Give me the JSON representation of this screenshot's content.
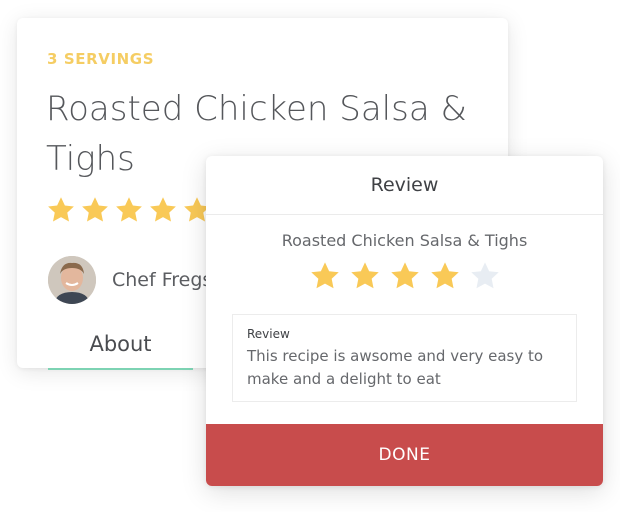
{
  "recipe_card": {
    "servings": "3 SERVINGS",
    "title": "Roasted Chicken Salsa & Tighs",
    "rating": 5,
    "chef_name": "Chef Fregs",
    "tab_about": "About"
  },
  "review_modal": {
    "header": "Review",
    "recipe_name": "Roasted Chicken Salsa & Tighs",
    "rating": 4,
    "max_rating": 5,
    "review_label": "Review",
    "review_text": "This recipe is awsome and very easy to make and a delight to eat",
    "done_label": "DONE"
  },
  "colors": {
    "star_filled": "#f9c957",
    "star_empty": "#e8edf3",
    "accent_tab": "#7dd3b3",
    "done_button": "#c84c4c"
  }
}
